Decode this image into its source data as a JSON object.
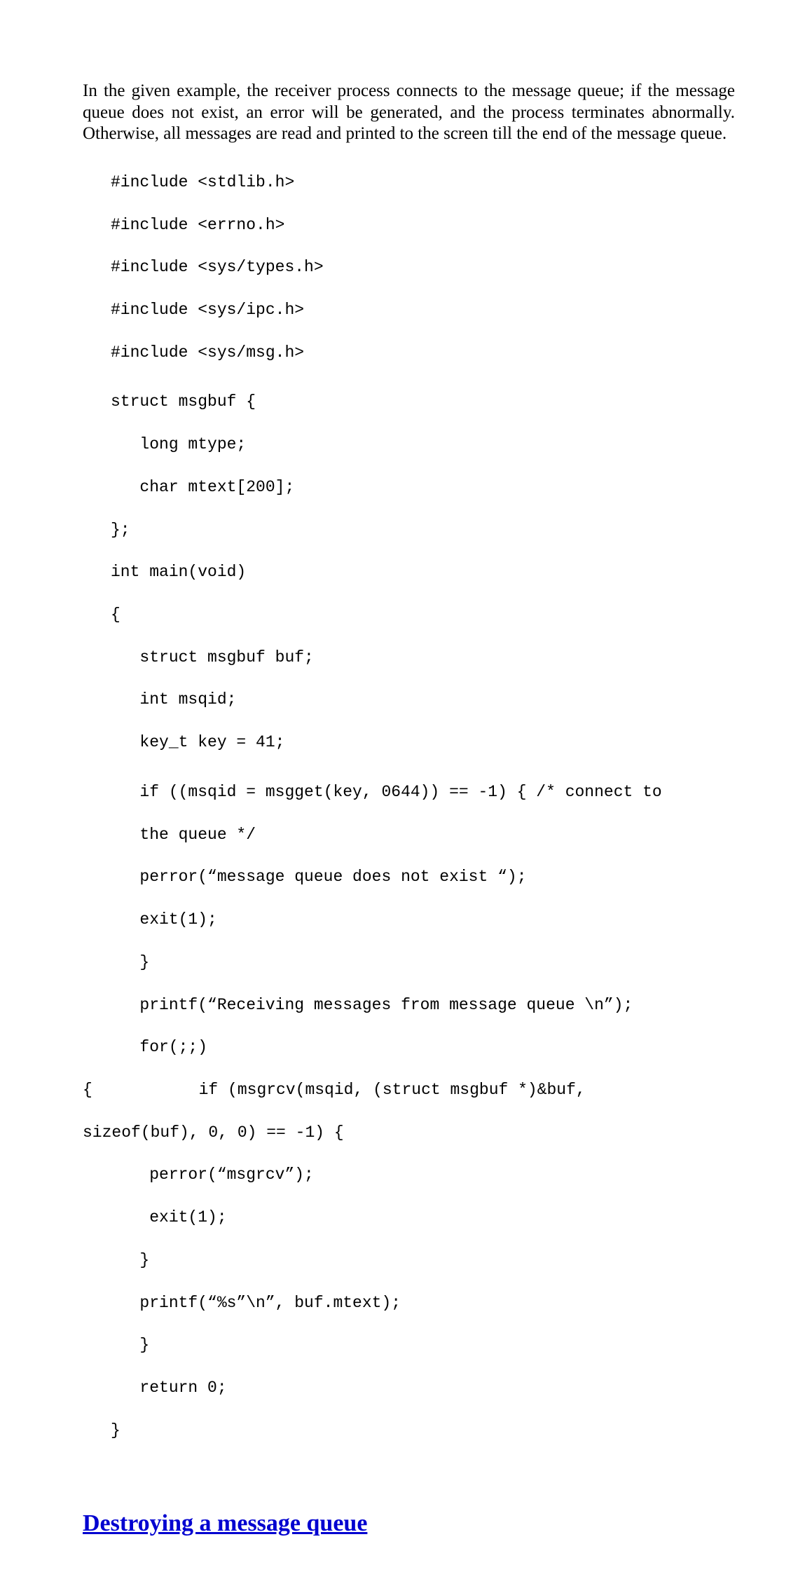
{
  "para": "In the given example, the receiver process connects to the message queue; if the message queue does not exist, an error will be generated, and the process terminates abnormally. Otherwise, all messages are read and printed to the screen till the end of the message queue.",
  "code": {
    "l01": "#include <stdlib.h>",
    "l02": "#include <errno.h>",
    "l03": "#include <sys/types.h>",
    "l04": "#include <sys/ipc.h>",
    "l05": "#include <sys/msg.h>",
    "l06": "struct msgbuf {",
    "l07": "   long mtype;",
    "l08": "   char mtext[200];",
    "l09": "};",
    "l10": "int main(void)",
    "l11": "{",
    "l12": "   struct msgbuf buf;",
    "l13": "   int msqid;",
    "l14": "   key_t key = 41;",
    "l15": "   if ((msqid = msgget(key, 0644)) == -1) { /* connect to",
    "l16": "   the queue */",
    "l17": "   perror(“message queue does not exist “);",
    "l18": "   exit(1);",
    "l19": "   }",
    "l20": "   printf(“Receiving messages from message queue \\n”);",
    "l21": "   for(;;)",
    "l22": "{           if (msgrcv(msqid, (struct msgbuf *)&buf,",
    "l23": "sizeof(buf), 0, 0) == -1) {",
    "l24": "    perror(“msgrcv”);",
    "l25": "    exit(1);",
    "l26": "   }",
    "l27": "   printf(“%s”\\n”, buf.mtext);",
    "l28": "   }",
    "l29": "   return 0;",
    "l30": "}"
  },
  "heading": "Destroying a message queue"
}
